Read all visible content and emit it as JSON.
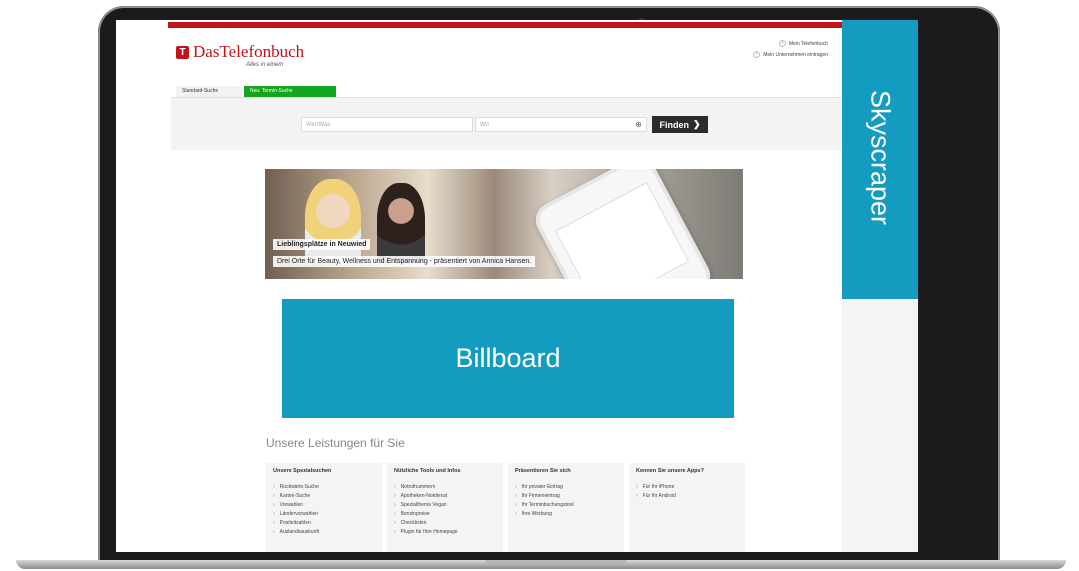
{
  "brand": {
    "logo_mark": "T",
    "name": "DasTelefonbuch",
    "tagline": "Alles in einem"
  },
  "top_links": [
    "Mein Telefonbuch",
    "Mein Unternehmen eintragen"
  ],
  "tabs": [
    {
      "label": "Standard-Suche"
    },
    {
      "label": "Neu: Termin-Suche"
    }
  ],
  "search": {
    "what_placeholder": "Wer/Was",
    "where_placeholder": "Wo",
    "find_label": "Finden",
    "find_arrow": "❯",
    "locate_icon": "⊕"
  },
  "hero": {
    "headline": "Lieblingsplätze in Neuwied",
    "caption": "Drei Orte für Beauty, Wellness und Entspannung - präsentiert von Annica Hansen."
  },
  "ads": {
    "billboard": "Billboard",
    "skyscraper": "Skyscraper"
  },
  "services": {
    "title": "Unsere Leistungen für Sie",
    "columns": [
      {
        "heading": "Unsere Spezialsuchen",
        "items": [
          "Rückwärts-Suche",
          "Karten-Suche",
          "Vorwahlen",
          "Ländervorwahlen",
          "Postleitzahlen",
          "Auslandsauskunft"
        ]
      },
      {
        "heading": "Nützliche Tools und Infos",
        "items": [
          "Notrufnummern",
          "Apotheken-Notdienst",
          "Spezialthema Vegan",
          "Benzinpreise",
          "Checklisten",
          "Plugin für Ihre Homepage"
        ]
      },
      {
        "heading": "Präsentieren Sie sich",
        "items": [
          "Ihr privater Eintrag",
          "Ihr Firmeneintrag",
          "Ihr Terminbuchungstool",
          "Ihre Werbung"
        ]
      },
      {
        "heading": "Kennen Sie unsere Apps?",
        "items": [
          "Für Ihr iPhone",
          "Für Ihr Android"
        ]
      }
    ]
  },
  "colors": {
    "brand_red": "#c3121a",
    "ad_blue": "#139cbf",
    "tab_green": "#12a61f",
    "find_button": "#2c2c2c"
  }
}
